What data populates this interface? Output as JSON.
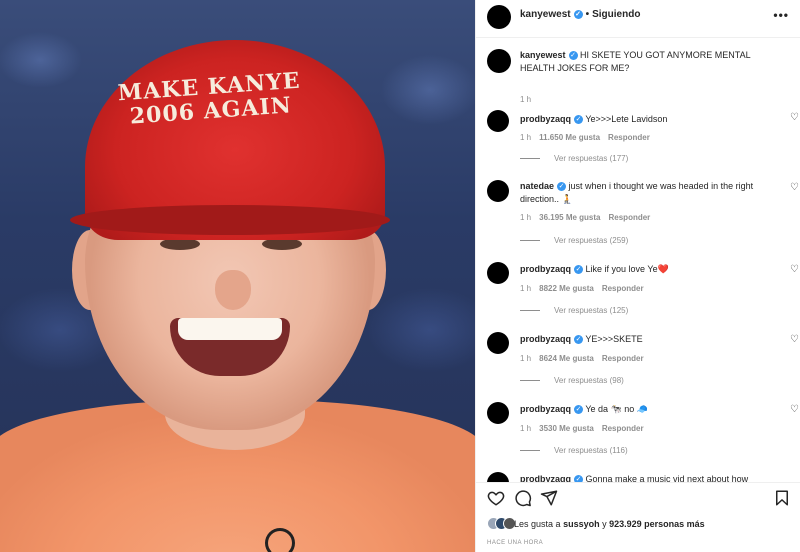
{
  "media": {
    "cap_line1": "MAKE KANYE",
    "cap_line2": "2006 AGAIN"
  },
  "header": {
    "username": "kanyewest",
    "separator": "•",
    "follow_label": "Siguiendo",
    "more": "•••"
  },
  "caption": {
    "username": "kanyewest",
    "text": "HI SKETE YOU GOT ANYMORE MENTAL HEALTH JOKES FOR ME?",
    "time": "1 h"
  },
  "comments": [
    {
      "username": "prodbyzaqq",
      "text": "Ye>>>Lete Lavidson",
      "time": "1 h",
      "likes": "11.650 Me gusta",
      "reply": "Responder",
      "replies": "Ver respuestas (177)"
    },
    {
      "username": "natedae",
      "text": "just when i thought we was headed in the right direction.. 🧎",
      "time": "1 h",
      "likes": "36.195 Me gusta",
      "reply": "Responder",
      "replies": "Ver respuestas (259)"
    },
    {
      "username": "prodbyzaqq",
      "text": "Like if you love Ye❤️",
      "time": "1 h",
      "likes": "8822 Me gusta",
      "reply": "Responder",
      "replies": "Ver respuestas (125)"
    },
    {
      "username": "prodbyzaqq",
      "text": "YE>>>SKETE",
      "time": "1 h",
      "likes": "8624 Me gusta",
      "reply": "Responder",
      "replies": "Ver respuestas (98)"
    },
    {
      "username": "prodbyzaqq",
      "text": "Ye da 🐄 no 🧢",
      "time": "1 h",
      "likes": "3530 Me gusta",
      "reply": "Responder",
      "replies": "Ver respuestas (116)"
    },
    {
      "username": "prodbyzaqq",
      "text": "Gonna make a music vid next about how SKETE",
      "time": "",
      "likes": "",
      "reply": "",
      "replies": ""
    }
  ],
  "actions": {
    "likes_prefix": "Les gusta a",
    "likes_user": "sussyoh",
    "likes_mid": "y",
    "likes_count": "923.929 personas más",
    "posted": "HACE UNA HORA"
  },
  "icons": {
    "like": "heart-icon",
    "comment": "comment-icon",
    "share": "share-icon",
    "save": "bookmark-icon"
  },
  "colors": {
    "verified": "#3897f0",
    "muted": "#8e8e8e",
    "text": "#262626"
  }
}
